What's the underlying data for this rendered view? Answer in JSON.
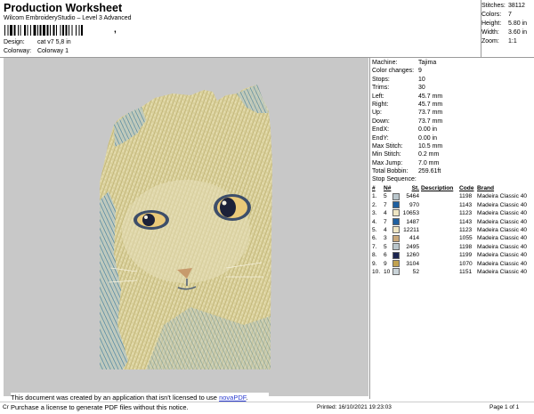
{
  "header": {
    "title": "Production Worksheet",
    "subtitle": "Wilcom EmbroideryStudio – Level 3 Advanced",
    "barcode_tail": ",",
    "design_label": "Design:",
    "design_value": "cat v7 5,8 in",
    "colorway_label": "Colorway:",
    "colorway_value": "Colorway 1"
  },
  "stats": [
    {
      "label": "Stitches:",
      "value": "38112"
    },
    {
      "label": "Colors:",
      "value": "7"
    },
    {
      "label": "Height:",
      "value": "5.80 in"
    },
    {
      "label": "Width:",
      "value": "3.60 in"
    },
    {
      "label": "Zoom:",
      "value": "1:1"
    }
  ],
  "machine": [
    {
      "label": "Machine:",
      "value": "Tajima"
    },
    {
      "label": "Color changes:",
      "value": "9"
    },
    {
      "label": "Stops:",
      "value": "10"
    },
    {
      "label": "Trims:",
      "value": "30"
    },
    {
      "label": "Left:",
      "value": "45.7 mm"
    },
    {
      "label": "Right:",
      "value": "45.7 mm"
    },
    {
      "label": "Up:",
      "value": "73.7 mm"
    },
    {
      "label": "Down:",
      "value": "73.7 mm"
    },
    {
      "label": "EndX:",
      "value": "0.00 in"
    },
    {
      "label": "EndY:",
      "value": "0.00 in"
    },
    {
      "label": "Max Stitch:",
      "value": "10.5 mm"
    },
    {
      "label": "Min Stitch:",
      "value": "0.2 mm"
    },
    {
      "label": "Max Jump:",
      "value": "7.0 mm"
    },
    {
      "label": "Total Bobbin:",
      "value": "259.61ft"
    }
  ],
  "stop_sequence": {
    "title": "Stop Sequence:",
    "columns": [
      "#",
      "N#",
      "St.",
      "Description",
      "Code",
      "Brand"
    ],
    "rows": [
      {
        "num": "1.",
        "n": "5",
        "color": "#b9c6cc",
        "st": "5464",
        "desc": "",
        "code": "1198",
        "brand": "Madeira Classic 40"
      },
      {
        "num": "2.",
        "n": "7",
        "color": "#1f5fa0",
        "st": "970",
        "desc": "",
        "code": "1143",
        "brand": "Madeira Classic 40"
      },
      {
        "num": "3.",
        "n": "4",
        "color": "#efe6c4",
        "st": "10653",
        "desc": "",
        "code": "1123",
        "brand": "Madeira Classic 40"
      },
      {
        "num": "4.",
        "n": "7",
        "color": "#1f5fa0",
        "st": "1487",
        "desc": "",
        "code": "1143",
        "brand": "Madeira Classic 40"
      },
      {
        "num": "5.",
        "n": "4",
        "color": "#efe6c4",
        "st": "12211",
        "desc": "",
        "code": "1123",
        "brand": "Madeira Classic 40"
      },
      {
        "num": "6.",
        "n": "3",
        "color": "#c9a87a",
        "st": "414",
        "desc": "",
        "code": "1055",
        "brand": "Madeira Classic 40"
      },
      {
        "num": "7.",
        "n": "5",
        "color": "#b9c6cc",
        "st": "2495",
        "desc": "",
        "code": "1198",
        "brand": "Madeira Classic 40"
      },
      {
        "num": "8.",
        "n": "6",
        "color": "#1b2450",
        "st": "1260",
        "desc": "",
        "code": "1199",
        "brand": "Madeira Classic 40"
      },
      {
        "num": "9.",
        "n": "9",
        "color": "#c2a24f",
        "st": "3104",
        "desc": "",
        "code": "1070",
        "brand": "Madeira Classic 40"
      },
      {
        "num": "10.",
        "n": "10",
        "color": "#c9d3d8",
        "st": "52",
        "desc": "",
        "code": "1151",
        "brand": "Madeira Classic 40"
      }
    ]
  },
  "notice": {
    "line1_prefix": "This document was created by an application that isn't licensed to use ",
    "link": "novaPDF",
    "line1_suffix": ".",
    "line2": "Purchase a license to generate PDF files without this notice."
  },
  "footer": {
    "left": "Cr",
    "printed": "Printed: 16/10/2021 19:23:03",
    "page": "Page 1 of 1"
  }
}
